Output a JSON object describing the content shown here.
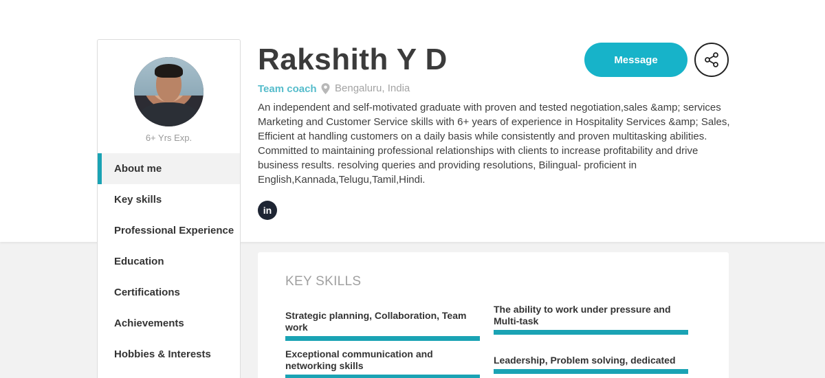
{
  "profile": {
    "name": "Rakshith Y D",
    "role": "Team coach",
    "location": "Bengaluru, India",
    "experience": "6+ Yrs Exp.",
    "bio": "An independent and self-motivated graduate with proven and tested negotiation,sales &amp; services Marketing and Customer Service skills with 6+ years of experience in Hospitality Services &amp; Sales, Efficient at handling customers on a daily basis while consistently and proven multitasking abilities. Committed to maintaining professional relationships with clients to increase profitability and drive business results. resolving queries and providing resolutions, Bilingual- proficient in English,Kannada,Telugu,Tamil,Hindi.",
    "linkedin_icon_text": "in"
  },
  "actions": {
    "message_label": "Message",
    "share_icon": "share-icon"
  },
  "sidebar": {
    "items": [
      {
        "label": "About me",
        "active": true
      },
      {
        "label": "Key skills",
        "active": false
      },
      {
        "label": "Professional Experience",
        "active": false
      },
      {
        "label": "Education",
        "active": false
      },
      {
        "label": "Certifications",
        "active": false
      },
      {
        "label": "Achievements",
        "active": false
      },
      {
        "label": "Hobbies & Interests",
        "active": false
      }
    ]
  },
  "key_skills": {
    "title": "KEY SKILLS",
    "skills": [
      "Strategic planning, Collaboration, Team work",
      "The ability to work under pressure and Multi-task",
      "Exceptional communication and networking skills",
      "Leadership, Problem solving, dedicated"
    ]
  },
  "colors": {
    "accent": "#17b3c9",
    "bar": "#1aa3b4",
    "role": "#55bccb",
    "linkedin": "#1e2533"
  }
}
